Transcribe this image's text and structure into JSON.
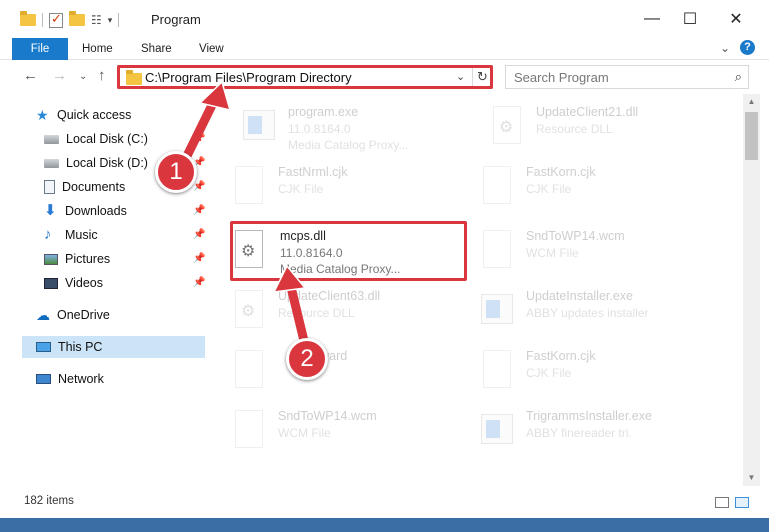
{
  "window": {
    "title": "Program",
    "controls": {
      "minimize": "—",
      "maximize": "☐",
      "close": "✕"
    }
  },
  "ribbon": {
    "tabs": [
      "File",
      "Home",
      "Share",
      "View"
    ],
    "expand": "⌄",
    "help": "?"
  },
  "address": {
    "path": "C:\\Program Files\\Program Directory",
    "dropdown": "⌄",
    "refresh": "↻"
  },
  "search": {
    "placeholder": "Search Program",
    "icon": "⌕"
  },
  "nav": {
    "back": "←",
    "forward": "→",
    "recent": "⌄",
    "up": "↑",
    "items": [
      {
        "label": "Quick access",
        "icon": "star-icon"
      },
      {
        "label": "Local Disk (C:)",
        "icon": "disk-icon"
      },
      {
        "label": "Local Disk (D:)",
        "icon": "disk-icon"
      },
      {
        "label": "Documents",
        "icon": "documents-icon"
      },
      {
        "label": "Downloads",
        "icon": "downloads-icon"
      },
      {
        "label": "Music",
        "icon": "music-icon"
      },
      {
        "label": "Pictures",
        "icon": "pictures-icon"
      },
      {
        "label": "Videos",
        "icon": "videos-icon"
      },
      {
        "label": "OneDrive",
        "icon": "onedrive-icon"
      },
      {
        "label": "This PC",
        "icon": "pc-icon"
      },
      {
        "label": "Network",
        "icon": "network-icon"
      }
    ]
  },
  "files": [
    {
      "name": "program.exe",
      "line2": "11.0.8164.0",
      "line3": "Media Catalog Proxy...",
      "icon": "exe-icon"
    },
    {
      "name": "UpdateClient21.dll",
      "line2": "Resource DLL",
      "line3": "",
      "icon": "dll-icon"
    },
    {
      "name": "FastNrml.cjk",
      "line2": "CJK File",
      "line3": "",
      "icon": "file-icon"
    },
    {
      "name": "FastKorn.cjk",
      "line2": "CJK File",
      "line3": "",
      "icon": "file-icon"
    },
    {
      "name": "mcps.dll",
      "line2": "11.0.8164.0",
      "line3": "Media Catalog Proxy...",
      "icon": "dll-icon"
    },
    {
      "name": "SndToWP14.wcm",
      "line2": "WCM File",
      "line3": "",
      "icon": "file-icon"
    },
    {
      "name": "UpdateClient63.dll",
      "line2": "Resource DLL",
      "line3": "",
      "icon": "dll-icon"
    },
    {
      "name": "UpdateInstaller.exe",
      "line2": "ABBY updates installer",
      "line3": "",
      "icon": "exe-icon"
    },
    {
      "name": "Award",
      "line2": "",
      "line3": "",
      "icon": "file-icon"
    },
    {
      "name": "FastKorn.cjk",
      "line2": "CJK File",
      "line3": "",
      "icon": "file-icon"
    },
    {
      "name": "SndToWP14.wcm",
      "line2": "WCM File",
      "line3": "",
      "icon": "file-icon"
    },
    {
      "name": "TrigrammsInstaller.exe",
      "line2": "ABBY finereader tri.",
      "line3": "",
      "icon": "exe-icon"
    }
  ],
  "status": {
    "items": "182 items"
  },
  "annotations": {
    "step1": "1",
    "step2": "2",
    "color": "#d9363e"
  }
}
